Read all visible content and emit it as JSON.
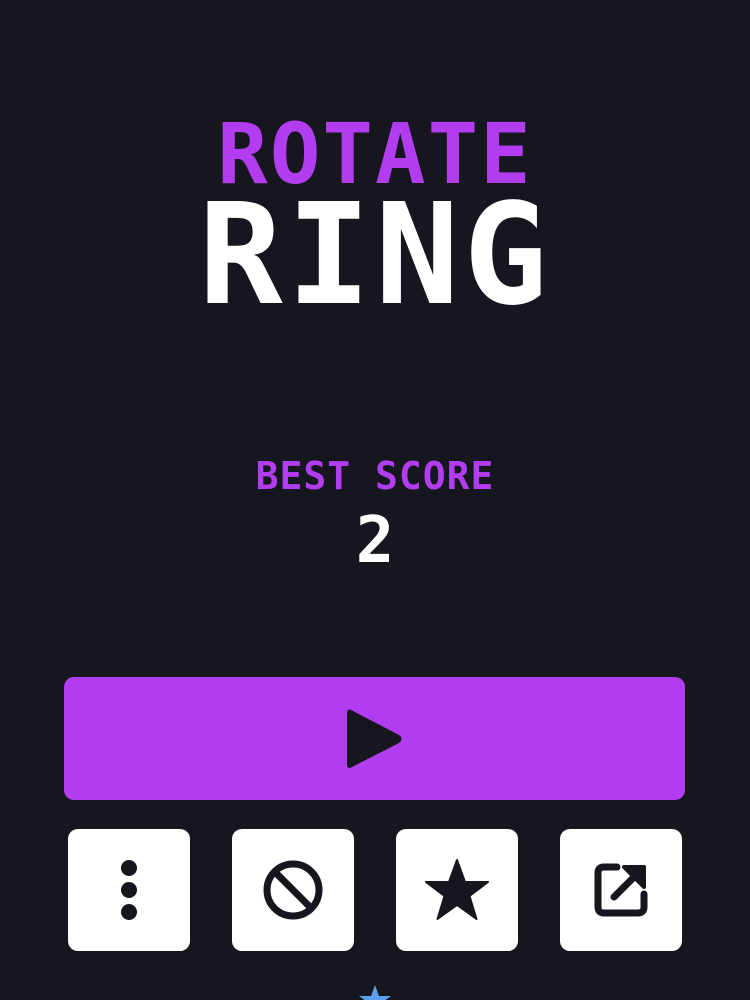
{
  "title": {
    "line1": "ROTATE",
    "line2": "RING"
  },
  "best_score": {
    "label": "BEST SCORE",
    "value": "2"
  },
  "buttons": {
    "play": "play-icon",
    "menu": "more-vertical-icon",
    "no_ads": "no-ads-icon",
    "rate": "star-icon",
    "share": "share-icon"
  },
  "colors": {
    "background": "#16161e",
    "accent": "#b23cf0",
    "text": "#ffffff",
    "button_bg": "#ffffff",
    "icon": "#16161e",
    "peek_icon": "#5aa0ee"
  }
}
